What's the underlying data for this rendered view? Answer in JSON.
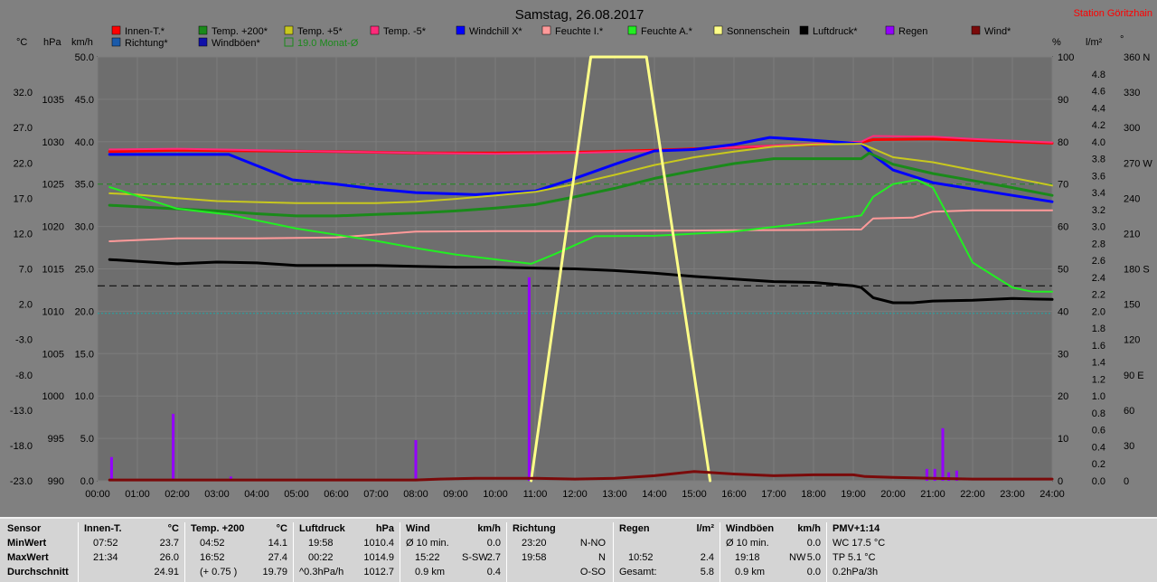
{
  "title": "Samstag, 26.08.2017",
  "station": "Station Göritzhain",
  "colors": {
    "plot_bg": "#6e6e6e",
    "grid": "#7c7c7c",
    "text": "#000000",
    "title": "#000000"
  },
  "axis_units": {
    "celsius": "°C",
    "hpa": "hPa",
    "kmh": "km/h",
    "percent": "%",
    "lm2": "l/m²",
    "deg": "°"
  },
  "legend": [
    {
      "label": "Innen-T.*",
      "color": "#ff0000"
    },
    {
      "label": "Temp. +200*",
      "color": "#1a8a1a"
    },
    {
      "label": "Temp. +5*",
      "color": "#c8c81e"
    },
    {
      "label": "Temp. -5*",
      "color": "#ff2a7a"
    },
    {
      "label": "Windchill X*",
      "color": "#0000ff"
    },
    {
      "label": "Feuchte I.*",
      "color": "#ff9a9a"
    },
    {
      "label": "Feuchte A.*",
      "color": "#22ee22"
    },
    {
      "label": "Sonnenschein",
      "color": "#ffff88"
    },
    {
      "label": "Luftdruck*",
      "color": "#000000"
    },
    {
      "label": "Regen",
      "color": "#9400ff"
    },
    {
      "label": "Wind*",
      "color": "#7a0a0a"
    },
    {
      "label": "Richtung*",
      "color": "#1a5aaa"
    },
    {
      "label": "Windböen*",
      "color": "#1010aa"
    },
    {
      "label": "19.0 Monat-Ø",
      "color": "#1a8a1a",
      "outline": true
    }
  ],
  "chart_data": {
    "type": "line",
    "title": "Samstag, 26.08.2017",
    "x_ticks": [
      "00:00",
      "01:00",
      "02:00",
      "03:00",
      "04:00",
      "05:00",
      "06:00",
      "07:00",
      "08:00",
      "09:00",
      "10:00",
      "11:00",
      "12:00",
      "13:00",
      "14:00",
      "15:00",
      "16:00",
      "17:00",
      "18:00",
      "19:00",
      "20:00",
      "21:00",
      "22:00",
      "23:00",
      "24:00"
    ],
    "xlim_hours": [
      0,
      24
    ],
    "axes": {
      "celsius": {
        "min": -23,
        "max": 37,
        "ticks": [
          "-23.0",
          "-18.0",
          "-13.0",
          "-8.0",
          "-3.0",
          "2.0",
          "7.0",
          "12.0",
          "17.0",
          "22.0",
          "27.0",
          "32.0"
        ]
      },
      "hpa": {
        "min": 990,
        "max": 1040,
        "ticks": [
          "990",
          "995",
          "1000",
          "1005",
          "1010",
          "1015",
          "1020",
          "1025",
          "1030",
          "1035"
        ]
      },
      "kmh": {
        "min": 0,
        "max": 50,
        "ticks": [
          "0.0",
          "5.0",
          "10.0",
          "15.0",
          "20.0",
          "25.0",
          "30.0",
          "35.0",
          "40.0",
          "45.0",
          "50.0"
        ]
      },
      "percent": {
        "min": 0,
        "max": 100,
        "ticks": [
          "0",
          "10",
          "20",
          "30",
          "40",
          "50",
          "60",
          "70",
          "80",
          "90",
          "100"
        ]
      },
      "lm2": {
        "min": 0,
        "max": 5,
        "ticks": [
          "0.0",
          "0.2",
          "0.4",
          "0.6",
          "0.8",
          "1.0",
          "1.2",
          "1.4",
          "1.6",
          "1.8",
          "2.0",
          "2.2",
          "2.4",
          "2.6",
          "2.8",
          "3.0",
          "3.2",
          "3.4",
          "3.6",
          "3.8",
          "4.0",
          "4.2",
          "4.4",
          "4.6",
          "4.8"
        ]
      },
      "deg": {
        "min": 0,
        "max": 360,
        "ticks": [
          "0",
          "30",
          "60",
          "90 E",
          "120",
          "150",
          "180 S",
          "210",
          "240",
          "270 W",
          "300",
          "330",
          "360 N"
        ]
      }
    },
    "series": [
      {
        "name": "Innen-T.*",
        "axis": "celsius",
        "color": "#ff0000",
        "width": 3,
        "points": [
          [
            0.3,
            23.6
          ],
          [
            2,
            23.8
          ],
          [
            4,
            23.7
          ],
          [
            6,
            23.6
          ],
          [
            8,
            23.4
          ],
          [
            10,
            23.4
          ],
          [
            12,
            23.5
          ],
          [
            14,
            23.8
          ],
          [
            16,
            24.2
          ],
          [
            18,
            24.6
          ],
          [
            19.2,
            24.9
          ],
          [
            19.5,
            25.3
          ],
          [
            21,
            25.4
          ],
          [
            22,
            25.2
          ],
          [
            24,
            24.8
          ]
        ]
      },
      {
        "name": "Temp. -5*",
        "axis": "celsius",
        "color": "#ff2a7a",
        "width": 2,
        "points": [
          [
            0.3,
            23.9
          ],
          [
            2,
            24.0
          ],
          [
            4,
            23.8
          ],
          [
            6,
            23.6
          ],
          [
            8,
            23.4
          ],
          [
            10,
            23.3
          ],
          [
            12,
            23.4
          ],
          [
            14,
            23.7
          ],
          [
            16,
            24.2
          ],
          [
            18,
            24.7
          ],
          [
            19.2,
            25.0
          ],
          [
            19.5,
            25.8
          ],
          [
            21,
            25.7
          ],
          [
            22,
            25.4
          ],
          [
            24,
            24.9
          ]
        ]
      },
      {
        "name": "Windchill X*",
        "axis": "celsius",
        "color": "#0000ff",
        "width": 3,
        "points": [
          [
            0.3,
            23.2
          ],
          [
            1,
            23.2
          ],
          [
            3.3,
            23.2
          ],
          [
            4.9,
            19.6
          ],
          [
            6,
            19.0
          ],
          [
            7,
            18.3
          ],
          [
            8,
            17.8
          ],
          [
            9.5,
            17.5
          ],
          [
            11,
            18.0
          ],
          [
            12,
            19.8
          ],
          [
            13,
            21.8
          ],
          [
            14,
            23.7
          ],
          [
            15,
            23.9
          ],
          [
            16,
            24.6
          ],
          [
            16.9,
            25.6
          ],
          [
            18,
            25.2
          ],
          [
            19.2,
            24.7
          ],
          [
            19.5,
            23.1
          ],
          [
            20,
            21.0
          ],
          [
            21,
            19.2
          ],
          [
            22,
            18.3
          ],
          [
            23,
            17.4
          ],
          [
            24,
            16.5
          ]
        ]
      },
      {
        "name": "Temp. +5*",
        "axis": "celsius",
        "color": "#c8c81e",
        "width": 2,
        "points": [
          [
            0.3,
            17.7
          ],
          [
            1,
            17.5
          ],
          [
            2,
            17.0
          ],
          [
            3,
            16.6
          ],
          [
            5,
            16.3
          ],
          [
            7,
            16.3
          ],
          [
            8,
            16.5
          ],
          [
            9,
            16.9
          ],
          [
            10,
            17.4
          ],
          [
            11,
            17.9
          ],
          [
            12,
            19.0
          ],
          [
            13,
            20.3
          ],
          [
            14,
            21.7
          ],
          [
            15,
            22.8
          ],
          [
            16,
            23.6
          ],
          [
            17,
            24.3
          ],
          [
            18,
            24.6
          ],
          [
            19.2,
            24.7
          ],
          [
            19.5,
            24.0
          ],
          [
            20,
            22.8
          ],
          [
            21,
            22.1
          ],
          [
            22,
            21.0
          ],
          [
            23,
            19.9
          ],
          [
            24,
            18.8
          ]
        ]
      },
      {
        "name": "Temp. +200*",
        "axis": "celsius",
        "color": "#1a8a1a",
        "width": 3,
        "points": [
          [
            0.3,
            16.0
          ],
          [
            1,
            15.8
          ],
          [
            2,
            15.5
          ],
          [
            3,
            15.2
          ],
          [
            4,
            14.8
          ],
          [
            5,
            14.5
          ],
          [
            6,
            14.5
          ],
          [
            7,
            14.7
          ],
          [
            8,
            14.9
          ],
          [
            9,
            15.2
          ],
          [
            10,
            15.6
          ],
          [
            11,
            16.1
          ],
          [
            12,
            17.2
          ],
          [
            13,
            18.4
          ],
          [
            14,
            19.8
          ],
          [
            15,
            20.9
          ],
          [
            16,
            21.9
          ],
          [
            17,
            22.6
          ],
          [
            18,
            22.6
          ],
          [
            19.2,
            22.6
          ],
          [
            19.4,
            23.4
          ],
          [
            20,
            21.8
          ],
          [
            21,
            20.5
          ],
          [
            22,
            19.5
          ],
          [
            23,
            18.5
          ],
          [
            24,
            17.4
          ]
        ]
      },
      {
        "name": "Feuchte I.*",
        "axis": "percent",
        "color": "#ff9a9a",
        "width": 2,
        "points": [
          [
            0.3,
            56.5
          ],
          [
            2,
            57.2
          ],
          [
            4,
            57.2
          ],
          [
            6,
            57.4
          ],
          [
            8,
            58.8
          ],
          [
            10,
            58.9
          ],
          [
            12,
            58.9
          ],
          [
            14,
            59.0
          ],
          [
            16,
            59.1
          ],
          [
            18,
            59.2
          ],
          [
            19.2,
            59.3
          ],
          [
            19.5,
            61.9
          ],
          [
            20.5,
            62.1
          ],
          [
            21,
            63.5
          ],
          [
            22,
            63.8
          ],
          [
            24,
            63.8
          ]
        ]
      },
      {
        "name": "Feuchte A.*",
        "axis": "percent",
        "color": "#22ee22",
        "width": 2,
        "points": [
          [
            0.3,
            69.3
          ],
          [
            2,
            64.2
          ],
          [
            3.3,
            62.8
          ],
          [
            5,
            59.5
          ],
          [
            7,
            56.6
          ],
          [
            8,
            54.9
          ],
          [
            9,
            53.4
          ],
          [
            10.9,
            51.2
          ],
          [
            11.5,
            53.5
          ],
          [
            12.5,
            57.7
          ],
          [
            14,
            57.8
          ],
          [
            16,
            58.8
          ],
          [
            18,
            61.0
          ],
          [
            19.2,
            62.6
          ],
          [
            19.5,
            67.0
          ],
          [
            20,
            70.0
          ],
          [
            20.6,
            71.0
          ],
          [
            21,
            69.2
          ],
          [
            21.5,
            60.5
          ],
          [
            22,
            51.5
          ],
          [
            23,
            45.6
          ],
          [
            23.5,
            44.6
          ],
          [
            24,
            44.6
          ]
        ]
      },
      {
        "name": "Luftdruck*",
        "axis": "hpa",
        "color": "#000000",
        "width": 3,
        "points": [
          [
            0.3,
            1016.1
          ],
          [
            1,
            1015.9
          ],
          [
            2,
            1015.6
          ],
          [
            3,
            1015.8
          ],
          [
            4,
            1015.7
          ],
          [
            5,
            1015.4
          ],
          [
            6,
            1015.4
          ],
          [
            7,
            1015.4
          ],
          [
            8,
            1015.3
          ],
          [
            9,
            1015.2
          ],
          [
            10,
            1015.2
          ],
          [
            11,
            1015.1
          ],
          [
            12,
            1015.0
          ],
          [
            13,
            1014.8
          ],
          [
            14,
            1014.5
          ],
          [
            15,
            1014.1
          ],
          [
            16,
            1013.8
          ],
          [
            17,
            1013.5
          ],
          [
            18,
            1013.4
          ],
          [
            19,
            1013.0
          ],
          [
            19.2,
            1012.8
          ],
          [
            19.5,
            1011.6
          ],
          [
            20,
            1011.0
          ],
          [
            20.5,
            1011.0
          ],
          [
            21,
            1011.2
          ],
          [
            22,
            1011.3
          ],
          [
            23,
            1011.5
          ],
          [
            24,
            1011.4
          ]
        ]
      },
      {
        "name": "Sonnenschein",
        "axis": "kmh",
        "color": "#ffff88",
        "width": 3,
        "points": [
          [
            10.9,
            0.0
          ],
          [
            12.4,
            50.0
          ],
          [
            13.8,
            50.0
          ],
          [
            15.4,
            0.0
          ]
        ]
      },
      {
        "name": "Wind*",
        "axis": "kmh",
        "color": "#7a0a0a",
        "width": 3,
        "points": [
          [
            0.3,
            0.1
          ],
          [
            8,
            0.1
          ],
          [
            8.6,
            0.2
          ],
          [
            9.5,
            0.3
          ],
          [
            11,
            0.3
          ],
          [
            12,
            0.2
          ],
          [
            13,
            0.3
          ],
          [
            14,
            0.6
          ],
          [
            15,
            1.1
          ],
          [
            16,
            0.8
          ],
          [
            17,
            0.6
          ],
          [
            18,
            0.7
          ],
          [
            19,
            0.7
          ],
          [
            19.3,
            0.5
          ],
          [
            20,
            0.4
          ],
          [
            21,
            0.3
          ],
          [
            22,
            0.2
          ],
          [
            24,
            0.2
          ]
        ]
      }
    ],
    "rain_bars": [
      [
        0.35,
        0.28
      ],
      [
        1.9,
        0.79
      ],
      [
        3.35,
        0.05
      ],
      [
        8.0,
        0.48
      ],
      [
        10.85,
        2.4
      ],
      [
        20.85,
        0.14
      ],
      [
        21.05,
        0.14
      ],
      [
        21.25,
        0.62
      ],
      [
        21.4,
        0.1
      ],
      [
        21.6,
        0.12
      ]
    ],
    "reference_lines": [
      {
        "name": "19.0 Monat-Ø",
        "axis": "celsius",
        "value": 19.0,
        "color": "#1a8a1a",
        "dash": "6,4"
      },
      {
        "name": "Luftdruck-Ø",
        "axis": "hpa",
        "value": 1013.0,
        "color": "#000000",
        "dash": "8,5"
      },
      {
        "name": "Feuchte-ref",
        "axis": "percent",
        "value": 39.5,
        "color": "#1fa8a8",
        "dash": "2,2"
      }
    ]
  },
  "panel": {
    "sensor": {
      "header": "Sensor",
      "min": "MinWert",
      "max": "MaxWert",
      "avg": "Durchschnitt"
    },
    "innen": {
      "h1": "Innen-T.",
      "h2": "°C",
      "min_t": "07:52",
      "min_v": "23.7",
      "max_t": "21:34",
      "max_v": "26.0",
      "avg_v": "24.91"
    },
    "temp": {
      "h1": "Temp. +200",
      "h2": "°C",
      "min_t": "04:52",
      "min_v": "14.1",
      "max_t": "16:52",
      "max_v": "27.4",
      "avg_t": "(+ 0.75 )",
      "avg_v": "19.79"
    },
    "druck": {
      "h1": "Luftdruck",
      "h2": "hPa",
      "min_t": "19:58",
      "min_v": "1010.4",
      "max_t": "00:22",
      "max_v": "1014.9",
      "avg_t": "^0.3hPa/h",
      "avg_v": "1012.7"
    },
    "wind": {
      "h1": "Wind",
      "h2": "km/h",
      "min_t": "Ø 10 min.",
      "min_v": "0.0",
      "max_t": "15:22",
      "max_m": "S-SW",
      "max_v": "2.7",
      "avg_t": "0.9 km",
      "avg_v": "0.4"
    },
    "richtung": {
      "h1": "Richtung",
      "min_t": "23:20",
      "min_v": "N-NO",
      "max_t": "19:58",
      "max_v": "N",
      "avg_v": "O-SO"
    },
    "regen": {
      "h1": "Regen",
      "h2": "l/m²",
      "max_t": "10:52",
      "max_v": "2.4",
      "avg_t": "Gesamt:",
      "avg_v": "5.8"
    },
    "boeen": {
      "h1": "Windböen",
      "h2": "km/h",
      "min_t": "Ø 10 min.",
      "min_v": "0.0",
      "max_t": "19:18",
      "max_m": "NW",
      "max_v": "5.0",
      "avg_t": "0.9 km",
      "avg_v": "0.0"
    },
    "pmv": {
      "h1": "PMV+1:14",
      "min_t": "WC 17.5 °C",
      "max_t": "TP 5.1 °C",
      "avg_t": "0.2hPa/3h"
    }
  }
}
